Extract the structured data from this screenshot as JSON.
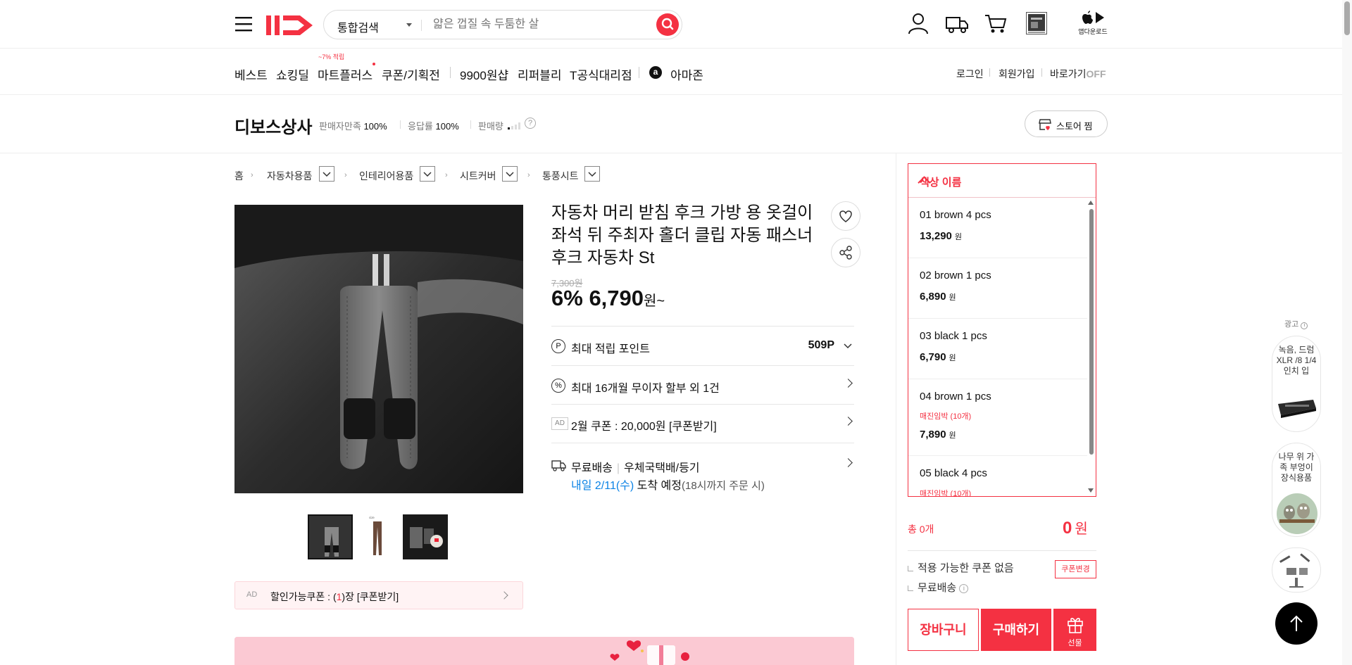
{
  "header": {
    "search_type": "통합검색",
    "search_placeholder": "얇은 껍질 속 두툼한 살",
    "app_download": "앱다운로드"
  },
  "nav": {
    "items": [
      "베스트",
      "쇼킹딜",
      "마트플러스",
      "쿠폰/기획전",
      "9900원샵",
      "리퍼블리",
      "T공식대리점",
      "아마존"
    ],
    "mart_badge": "~7% 적립",
    "right_links": [
      "로그인",
      "회원가입",
      "바로가기"
    ],
    "shortcut_state": "OFF"
  },
  "store": {
    "name": "디보스상사",
    "satisfaction_label": "판매자만족",
    "satisfaction_value": "100%",
    "response_label": "응답률",
    "response_value": "100%",
    "sales_label": "판매량",
    "help": "?",
    "zzim_label": "스토어 찜"
  },
  "breadcrumb": [
    "홈",
    "자동차용품",
    "인테리어용품",
    "시트커버",
    "통풍시트"
  ],
  "product": {
    "title": "자동차 머리 받침 후크 가방 용 옷걸이 좌석 뒤 주최자 홀더 클립 자동 패스너 후크 자동차 St",
    "original_price": "7,300원",
    "discount": "6%",
    "price": "6,790",
    "price_suffix": "원~",
    "points_label": "최대 적립 포인트",
    "points_value": "509P",
    "installment": "최대 16개월 무이자 할부 외 1건",
    "coupon_ad": "AD",
    "coupon_text": "2월 쿠폰 : 20,000원 [쿠폰받기]",
    "shipping_free": "무료배송",
    "shipping_method": "우체국택배/등기",
    "delivery_date": "내일 2/11(수)",
    "delivery_text": "도착 예정",
    "delivery_note": "(18시까지 주문 시)",
    "discount_coupon_ad": "AD",
    "discount_coupon_prefix": "할인가능쿠폰 : (",
    "discount_coupon_count": "1",
    "discount_coupon_suffix": ")장 [쿠폰받기]"
  },
  "options": {
    "header": "색상 이름",
    "items": [
      {
        "name": "01 brown 4 pcs",
        "price": "13,290",
        "note": ""
      },
      {
        "name": "02 brown 1 pcs",
        "price": "6,890",
        "note": ""
      },
      {
        "name": "03 black 1 pcs",
        "price": "6,790",
        "note": ""
      },
      {
        "name": "04 brown 1 pcs",
        "price": "7,890",
        "note": "매진임박 (10개)"
      },
      {
        "name": "05 black 4 pcs",
        "price": "",
        "note": "매진임박 (10개)"
      }
    ],
    "won": "원"
  },
  "order": {
    "total_label": "총 0개",
    "total_price": "0",
    "total_won": "원",
    "no_coupon": "적용 가능한 쿠폰 없음",
    "free_shipping": "무료배송",
    "coupon_change": "쿠폰변경",
    "cart": "장바구니",
    "buy": "구매하기",
    "gift": "선물"
  },
  "side_ads": {
    "label": "광고",
    "card1": "녹음, 드럼 XLR /8 1/4인치 입",
    "card2": "나무 위 가족 부엉이 장식용품"
  },
  "colors": {
    "accent": "#f43142",
    "link_blue": "#0b83e6"
  }
}
